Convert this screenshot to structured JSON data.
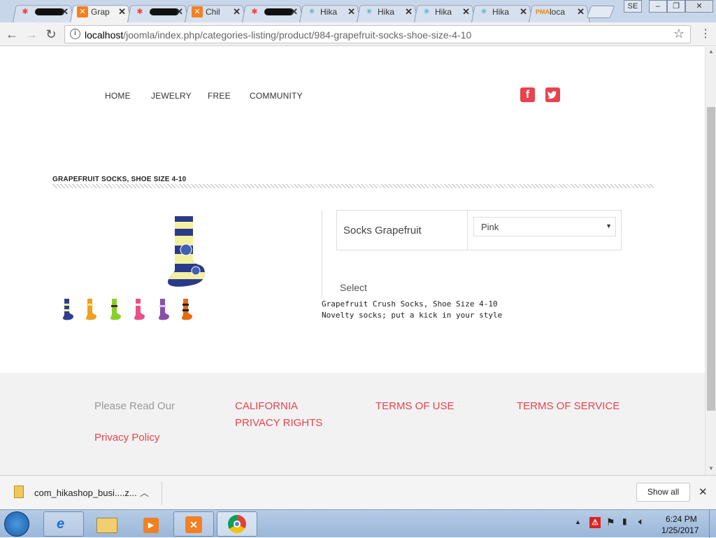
{
  "browser": {
    "tabs": [
      {
        "title": "",
        "icon": "joomla-icon",
        "redacted": true
      },
      {
        "title": "Grap",
        "icon": "xampp-icon",
        "active": true
      },
      {
        "title": "",
        "icon": "joomla-icon",
        "redacted": true
      },
      {
        "title": "Chil",
        "icon": "xampp-icon"
      },
      {
        "title": "",
        "icon": "joomla-icon",
        "redacted": true
      },
      {
        "title": "Hika",
        "icon": "hikashop-icon"
      },
      {
        "title": "Hika",
        "icon": "hikashop-icon"
      },
      {
        "title": "Hika",
        "icon": "hikashop-icon"
      },
      {
        "title": "Hika",
        "icon": "hikashop-icon"
      },
      {
        "title": "loca",
        "icon": "phpmyadmin-icon"
      }
    ],
    "url_host": "localhost",
    "url_path": "/joomla/index.php/categories-listing/product/984-grapefruit-socks-shoe-size-4-10",
    "user_badge": "SE"
  },
  "nav": {
    "items": [
      "HOME",
      "JEWELRY",
      "FREE",
      "COMMUNITY"
    ]
  },
  "product": {
    "title": "GRAPEFRUIT SOCKS, SHOE SIZE 4-10",
    "option_label": "Socks Grapefruit",
    "option_value": "Pink",
    "select_label": "Select",
    "description_line1": "Grapefruit Crush Socks, Shoe Size 4-10",
    "description_line2": "Novelty socks; put a kick in your style",
    "thumb_colors": [
      "#2f3f8f",
      "#f0a020",
      "#8bcf2a",
      "#e8508a",
      "#8a4fa8",
      "#e86a10"
    ]
  },
  "footer": {
    "please_read": "Please Read Our",
    "privacy_policy": "Privacy Policy",
    "california_line1": "CALIFORNIA",
    "california_line2": "PRIVACY RIGHTS",
    "terms_of_use": "TERMS OF USE",
    "terms_of_service": "TERMS OF SERVICE"
  },
  "download_shelf": {
    "file_name": "com_hikashop_busi....z...",
    "show_all": "Show all"
  },
  "taskbar": {
    "time": "6:24 PM",
    "date": "1/25/2017"
  },
  "colors": {
    "accent": "#e8434f",
    "footer_bg": "#f2f2f2"
  }
}
